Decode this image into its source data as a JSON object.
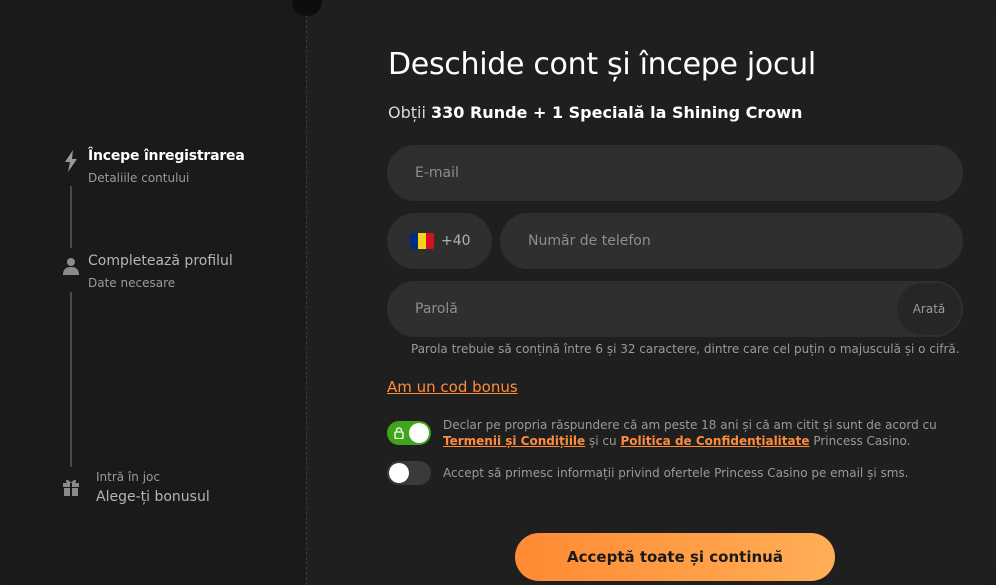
{
  "sidebar": {
    "steps": [
      {
        "title": "Începe înregistrarea",
        "subtitle": "Detaliile contului",
        "icon": "lightning-icon"
      },
      {
        "title": "Completează profilul",
        "subtitle": "Date necesare",
        "icon": "user-icon"
      },
      {
        "title": "Intră în joc",
        "subtitle": "Alege-ți bonusul",
        "icon": "gift-icon"
      }
    ]
  },
  "form": {
    "heading": "Deschide cont și începe jocul",
    "subheading_prefix": "Obții",
    "subheading_bold": "330 Runde + 1 Specială la Shining Crown",
    "email_placeholder": "E-mail",
    "phone_prefix": "+40",
    "phone_placeholder": "Număr de telefon",
    "password_placeholder": "Parolă",
    "show_password_label": "Arată",
    "password_hint": "Parola trebuie să conțină între 6 și 32 caractere, dintre care cel puțin o majusculă și o cifră.",
    "bonus_code_link": "Am un cod bonus",
    "consent_terms": {
      "line1": "Declar pe propria răspundere că am peste 18 ani și că am citit și sunt de acord cu",
      "terms_link": "Termenii și Condițiile",
      "and_text": "și cu",
      "privacy_link": "Politica de Confidențialitate",
      "end_text": "Princess Casino.",
      "checked": true
    },
    "consent_marketing": {
      "text": "Accept să primesc informații privind ofertele Princess Casino pe email și sms.",
      "checked": false
    },
    "submit_label": "Acceptă toate și continuă"
  },
  "colors": {
    "accent": "#ff8c3a",
    "toggle_on": "#3fa61c",
    "flag": [
      "#002b7f",
      "#fcd116",
      "#ce1126"
    ]
  }
}
